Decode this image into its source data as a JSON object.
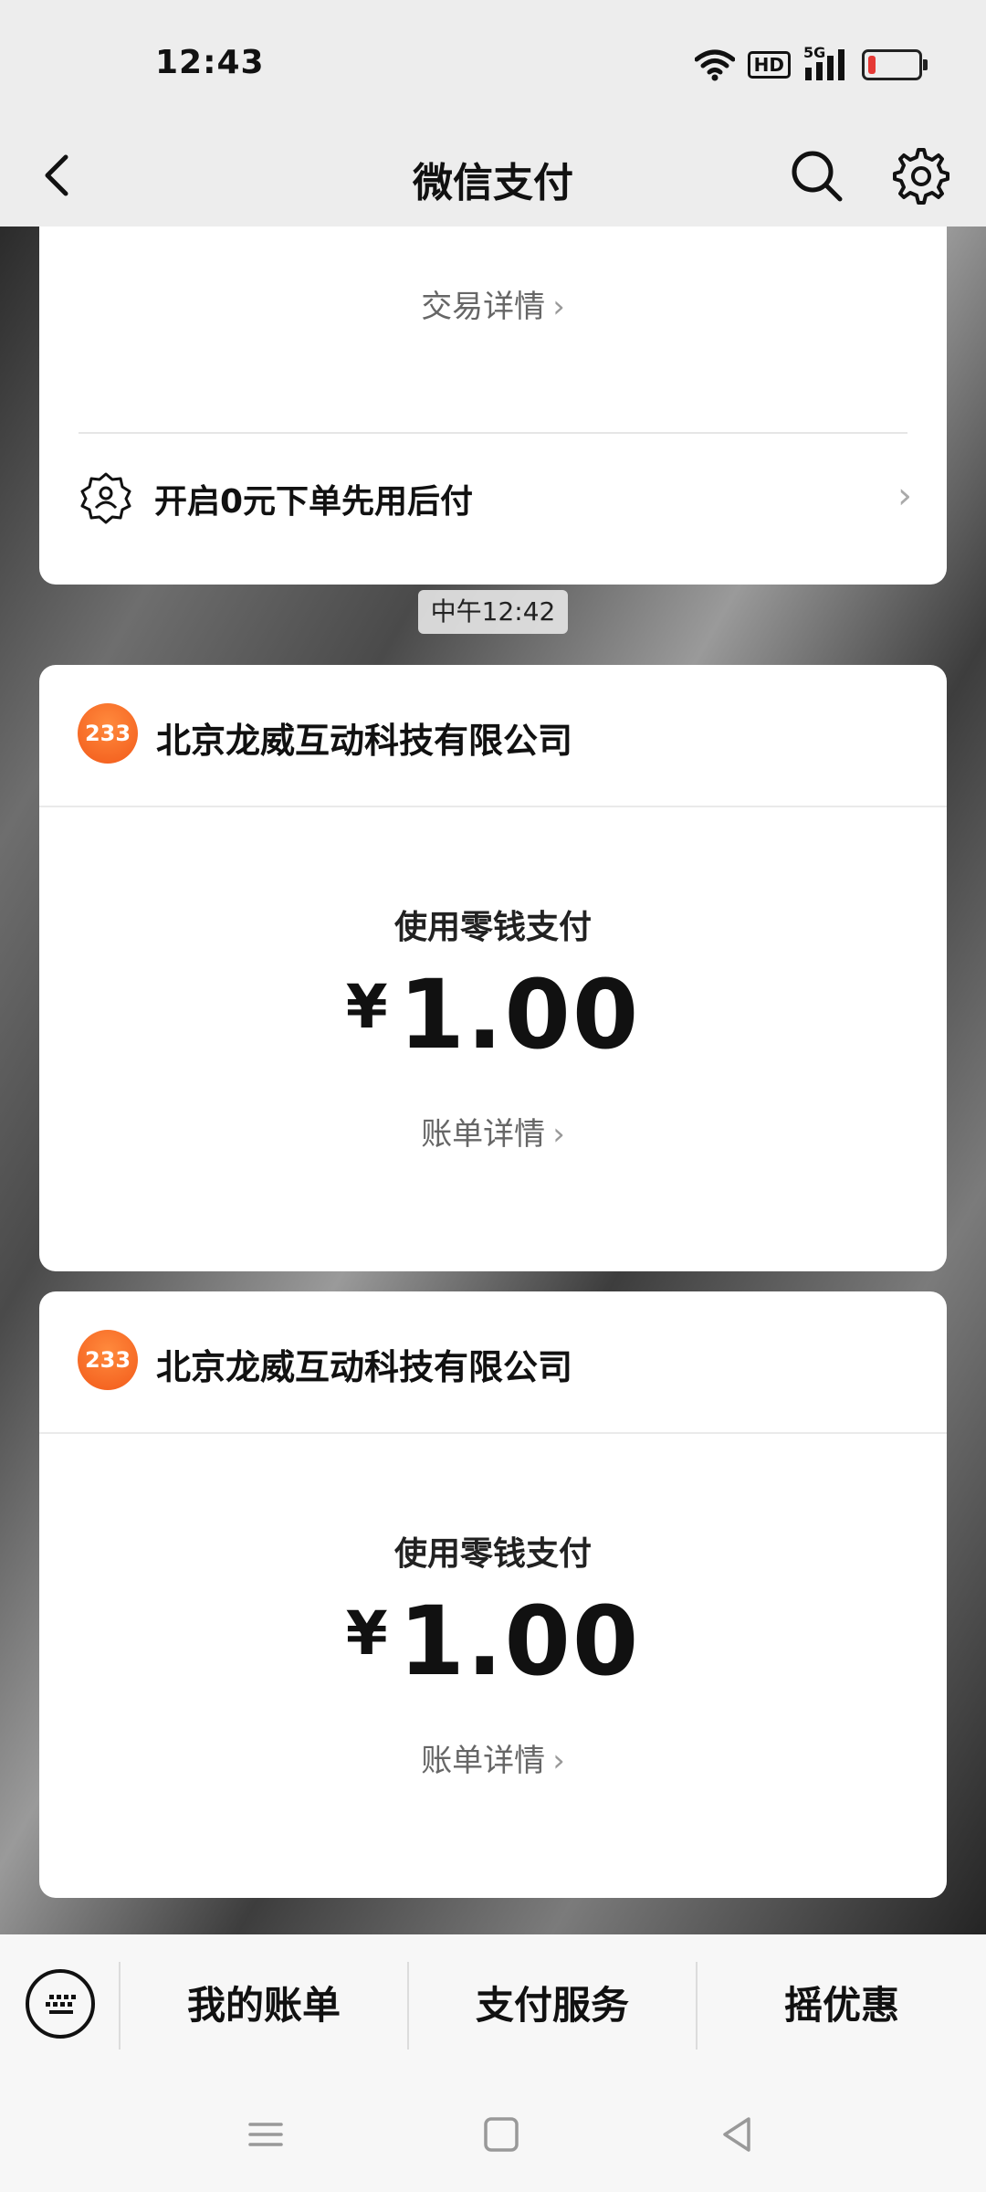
{
  "status": {
    "time": "12:43",
    "hd_label": "HD",
    "network_label": "5G"
  },
  "nav": {
    "title": "微信支付"
  },
  "top_card": {
    "detail_label": "交易详情",
    "feature_label": "开启0元下单先用后付"
  },
  "time_divider": "中午12:42",
  "transactions": [
    {
      "logo_text": "233",
      "merchant": "北京龙威互动科技有限公司",
      "method": "使用零钱支付",
      "currency": "¥",
      "amount": "1.00",
      "detail_label": "账单详情"
    },
    {
      "logo_text": "233",
      "merchant": "北京龙威互动科技有限公司",
      "method": "使用零钱支付",
      "currency": "¥",
      "amount": "1.00",
      "detail_label": "账单详情"
    }
  ],
  "tabbar": {
    "tabs": [
      "我的账单",
      "支付服务",
      "摇优惠"
    ]
  },
  "chevron": "›",
  "colors": {
    "background": "#ededed",
    "card": "#ffffff",
    "logo": "#f25a1a",
    "battery_low": "#e53935"
  }
}
